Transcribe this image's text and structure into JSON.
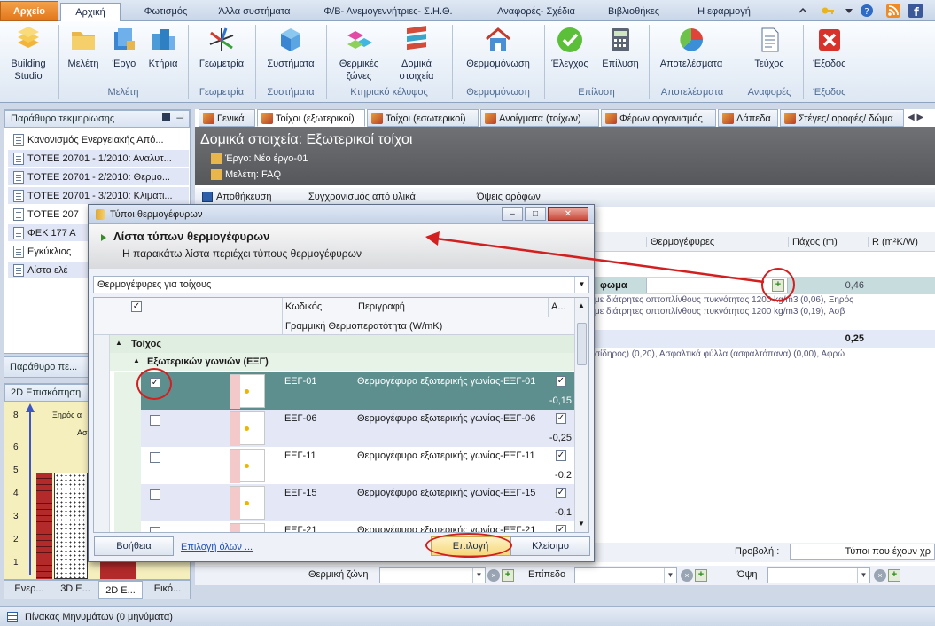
{
  "ribbon_tabs": {
    "file": "Αρχείο",
    "home": "Αρχική",
    "lighting": "Φωτισμός",
    "other_systems": "Άλλα συστήματα",
    "pv": "Φ/Β- Ανεμογεννήτριες- Σ.Η.Θ.",
    "reports": "Αναφορές- Σχέδια",
    "libraries": "Βιβλιοθήκες",
    "application": "Η εφαρμογή"
  },
  "ribbon": {
    "building_studio": "Building Studio",
    "study": "Μελέτη",
    "project": "Έργο",
    "buildings": "Κτήρια",
    "group_study": "Μελέτη",
    "geometry": "Γεωμετρία",
    "group_geometry": "Γεωμετρία",
    "systems": "Συστήματα",
    "group_systems": "Συστήματα",
    "thermal_zones": "Θερμικές ζώνες",
    "structural_elements": "Δομικά στοιχεία",
    "group_envelope": "Κτηριακό κέλυφος",
    "insulation": "Θερμομόνωση",
    "group_insulation": "Θερμομόνωση",
    "check": "Έλεγχος",
    "solution": "Επίλυση",
    "group_solution": "Επίλυση",
    "results": "Αποτελέσματα",
    "group_results": "Αποτελέσματα",
    "booklet": "Τεύχος",
    "group_reports": "Αναφορές",
    "exit": "Έξοδος",
    "group_exit": "Έξοδος"
  },
  "docs_panel": {
    "title": "Παράθυρο τεκμηρίωσης",
    "items": [
      "Κανονισμός Ενεργειακής Από...",
      "ΤΟΤΕΕ 20701 - 1/2010: Αναλυτ...",
      "ΤΟΤΕΕ 20701 - 2/2010: Θερμο...",
      "ΤΟΤΕΕ 20701 - 3/2010: Κλιματι...",
      "ΤΟΤΕΕ 207",
      "ΦΕΚ 177 Α",
      "Εγκύκλιος",
      "Λίστα ελέ"
    ],
    "footer": "Παράθυρο πε..."
  },
  "overview_panel": {
    "title": "2D Επισκόπηση",
    "label1": "Ξηρός α",
    "label2": "Ασ",
    "axis": [
      "8",
      "6",
      "5",
      "4",
      "3",
      "2",
      "1"
    ],
    "tabs": [
      "Ενερ...",
      "3D Ε...",
      "2D E...",
      "Εικό..."
    ]
  },
  "main_tabs": [
    "Γενικά",
    "Τοίχοι (εξωτερικοί)",
    "Τοίχοι (εσωτερικοί)",
    "Ανοίγματα (τοίχων)",
    "Φέρων οργανισμός",
    "Δάπεδα",
    "Στέγες/ οροφές/ δώμα"
  ],
  "main_header": {
    "title": "Δομικά στοιχεία: Εξωτερικοί τοίχοι",
    "project": "Έργο: Νέο έργο-01",
    "study": "Μελέτη: FAQ"
  },
  "main_toolbar": {
    "save": "Αποθήκευση",
    "sync": "Συγχρονισμός από υλικά",
    "views": "Όψεις ορόφων"
  },
  "main_grid": {
    "col_thermal_bridges": "Θερμογέφυρες",
    "col_thickness": "Πάχος (m)",
    "col_r": "R (m²K/W)",
    "row1_label": "φωμα",
    "row1_thickness": "0,46",
    "row1_desc1": "με διάτρητες οπτοπλίνθους πυκνότητας 1200 kg/m3 (0,06), Ξηρός",
    "row1_desc2": "με διάτρητες οπτοπλίνθους πυκνότητας 1200 kg/m3 (0,19), Ασβ",
    "row2_thickness": "0,25",
    "row2_desc": "σίδηρος)  (0,20), Ασφαλτικά φύλλα (ασφαλτόπανα) (0,00), Αφρώ"
  },
  "bottom_bar": {
    "view_label": "Προβολή :",
    "view_value": "Τύποι που έχουν χρ",
    "thermal_zone_label": "Θερμική ζώνη",
    "level_label": "Επίπεδο",
    "facade_label": "Όψη"
  },
  "status_bar": {
    "messages": "Πίνακας Μηνυμάτων (0 μηνύματα)"
  },
  "dialog": {
    "title": "Τύποι θερμογέφυρων",
    "heading": "Λίστα τύπων θερμογέφυρων",
    "subheading": "Η παρακάτω λίστα περιέχει τύπους θερμογέφυρων",
    "filter_value": "Θερμογέφυρες για τοίχους",
    "col_code": "Κωδικός",
    "col_description": "Περιγραφή",
    "col_a": "A...",
    "subheader": "Γραμμική Θερμοπερατότητα (W/mK)",
    "group": "Τοίχος",
    "subgroup": "Εξωτερικών γωνιών (ΕΞΓ)",
    "rows": [
      {
        "code": "ΕΞΓ-01",
        "description": "Θερμογέφυρα εξωτερικής γωνίας-ΕΞΓ-01",
        "value": "-0,15",
        "selected": true
      },
      {
        "code": "ΕΞΓ-06",
        "description": "Θερμογέφυρα εξωτερικής γωνίας-ΕΞΓ-06",
        "value": "-0,25",
        "selected": false
      },
      {
        "code": "ΕΞΓ-11",
        "description": "Θερμογέφυρα εξωτερικής γωνίας-ΕΞΓ-11",
        "value": "-0,2",
        "selected": false
      },
      {
        "code": "ΕΞΓ-15",
        "description": "Θερμογέφυρα εξωτερικής γωνίας-ΕΞΓ-15",
        "value": "-0,1",
        "selected": false
      },
      {
        "code": "ΕΞΓ-21",
        "description": "Θερμογέφυρα εξωτερικής γωνίας-ΕΞΓ-21",
        "value": "",
        "selected": false
      }
    ],
    "help": "Βοήθεια",
    "select_all": "Επιλογή όλων ...",
    "select": "Επιλογή",
    "close": "Κλείσιμο"
  },
  "colors": {
    "highlight_ring": "#d21f1f",
    "selected_row": "#5e8f8f",
    "file_tab": "#e2761b"
  }
}
